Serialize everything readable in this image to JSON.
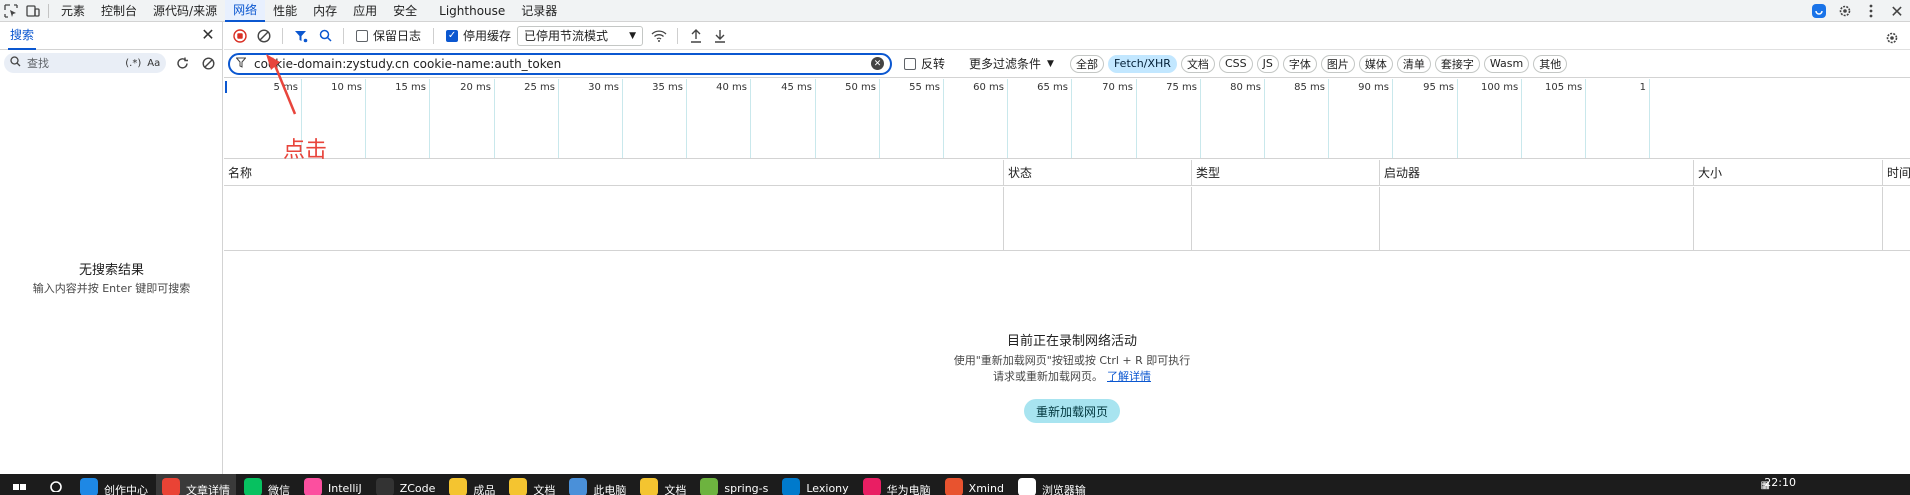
{
  "tabbar": {
    "tabs": [
      {
        "label": "元素",
        "active": false
      },
      {
        "label": "控制台",
        "active": false
      },
      {
        "label": "源代码/来源",
        "active": false
      },
      {
        "label": "网络",
        "active": true
      },
      {
        "label": "性能",
        "active": false
      },
      {
        "label": "内存",
        "active": false
      },
      {
        "label": "应用",
        "active": false
      },
      {
        "label": "安全",
        "active": false
      },
      {
        "label": "Lighthouse",
        "active": false
      },
      {
        "label": "记录器",
        "active": false
      }
    ]
  },
  "leftpanel": {
    "tab_label": "搜索",
    "search_placeholder": "查找",
    "regex_label": "(.*)",
    "case_label": "Aa",
    "empty_title": "无搜索结果",
    "empty_hint": "输入内容并按 Enter 键即可搜索"
  },
  "toolbar": {
    "preserve_log_label": "保留日志",
    "preserve_log_checked": false,
    "disable_cache_label": "停用缓存",
    "disable_cache_checked": true,
    "throttle_value": "已停用节流模式"
  },
  "filterbar": {
    "filter_value": "cookie-domain:zystudy.cn cookie-name:auth_token",
    "invert_label": "反转",
    "invert_checked": false,
    "more_filters_label": "更多过滤条件",
    "chips": [
      {
        "label": "全部",
        "active": false
      },
      {
        "label": "Fetch/XHR",
        "active": true
      },
      {
        "label": "文档",
        "active": false
      },
      {
        "label": "CSS",
        "active": false
      },
      {
        "label": "JS",
        "active": false
      },
      {
        "label": "字体",
        "active": false
      },
      {
        "label": "图片",
        "active": false
      },
      {
        "label": "媒体",
        "active": false
      },
      {
        "label": "清单",
        "active": false
      },
      {
        "label": "套接字",
        "active": false
      },
      {
        "label": "Wasm",
        "active": false
      },
      {
        "label": "其他",
        "active": false
      }
    ]
  },
  "timeline": {
    "ticks": [
      "5 ms",
      "10 ms",
      "15 ms",
      "20 ms",
      "25 ms",
      "30 ms",
      "35 ms",
      "40 ms",
      "45 ms",
      "50 ms",
      "55 ms",
      "60 ms",
      "65 ms",
      "70 ms",
      "75 ms",
      "80 ms",
      "85 ms",
      "90 ms",
      "95 ms",
      "100 ms",
      "105 ms",
      "1"
    ]
  },
  "table": {
    "columns": [
      "名称",
      "状态",
      "类型",
      "启动器",
      "大小",
      "时间"
    ]
  },
  "empty_state": {
    "title": "目前正在录制网络活动",
    "line1": "使用\"重新加载网页\"按钮或按 Ctrl + R 即可执行",
    "line2": "请求或重新加载网页。",
    "learn_more": "了解详情",
    "reload_button": "重新加载网页"
  },
  "annotation": {
    "text": "点击",
    "color": "#e8453c"
  },
  "taskbar": {
    "items": [
      {
        "label": "创作中心",
        "color": "#1e88e5",
        "active": false
      },
      {
        "label": "文章详情",
        "color": "#ea4335",
        "active": true
      },
      {
        "label": "微信",
        "color": "#07c160",
        "active": false
      },
      {
        "label": "IntelliJ",
        "color": "#fc4f9f",
        "active": false
      },
      {
        "label": "ZCode",
        "color": "#333333",
        "active": false
      },
      {
        "label": "成品",
        "color": "#f4c430",
        "active": false
      },
      {
        "label": "文档",
        "color": "#f4c430",
        "active": false
      },
      {
        "label": "此电脑",
        "color": "#4a90d9",
        "active": false
      },
      {
        "label": "文档",
        "color": "#f4c430",
        "active": false
      },
      {
        "label": "spring-s",
        "color": "#6db33f",
        "active": false
      },
      {
        "label": "Lexiony",
        "color": "#007acc",
        "active": false
      },
      {
        "label": "华为电脑",
        "color": "#e91e63",
        "active": false
      },
      {
        "label": "Xmind",
        "color": "#e8532f",
        "active": false
      },
      {
        "label": "浏览器输",
        "color": "#ffffff",
        "active": false
      }
    ],
    "time": "22:10"
  },
  "colors": {
    "accent": "#0b57d0",
    "chip_active": "#c2e7ff",
    "record_red": "#d93025",
    "reload_button": "#a8e4f0"
  }
}
